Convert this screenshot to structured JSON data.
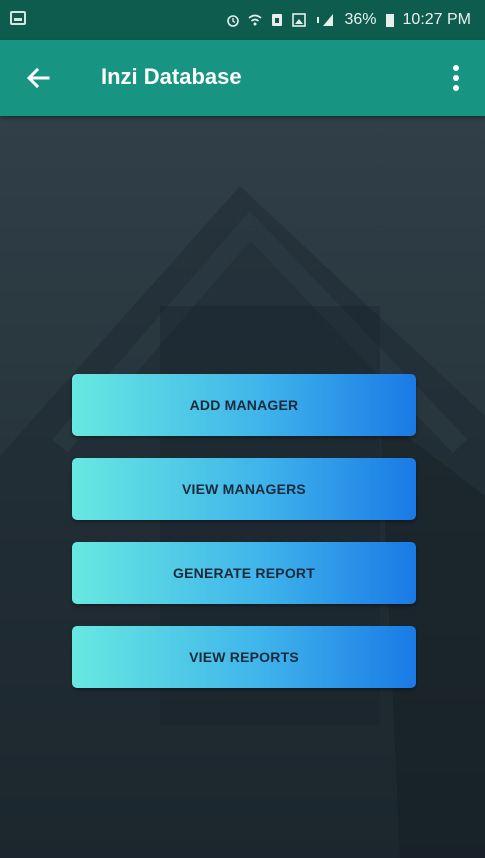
{
  "status_bar": {
    "battery": "36%",
    "time": "10:27 PM"
  },
  "app_bar": {
    "title": "Inzi Database"
  },
  "menu": {
    "buttons": [
      {
        "label": "ADD MANAGER"
      },
      {
        "label": "VIEW MANAGERS"
      },
      {
        "label": "GENERATE REPORT"
      },
      {
        "label": "VIEW REPORTS"
      }
    ]
  },
  "colors": {
    "status_bar": "#0d5c4e",
    "app_bar": "#179582",
    "button_gradient_start": "#67e8e0",
    "button_gradient_end": "#1a7ae6",
    "button_text": "#1a2a3a"
  }
}
